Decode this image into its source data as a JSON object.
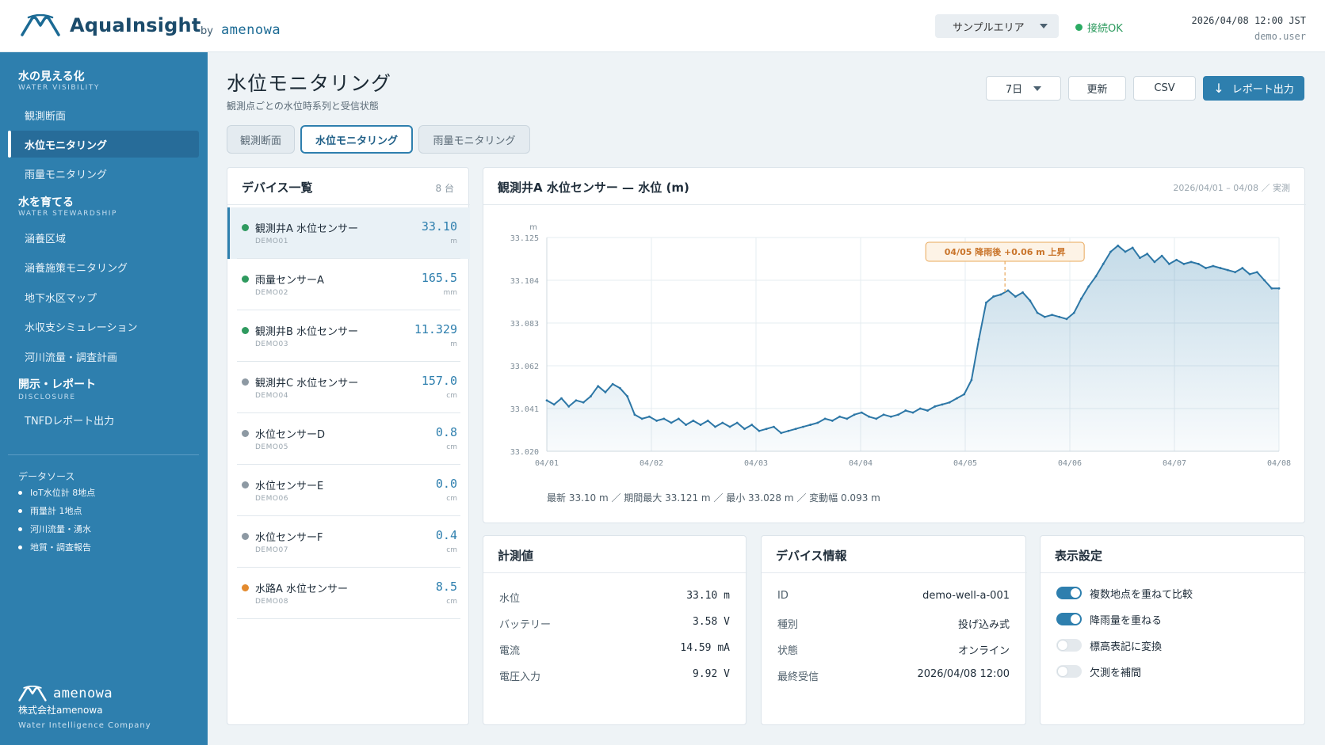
{
  "header": {
    "app_name": "AquaInsight",
    "by": "by",
    "brand": "amenowa",
    "area_select": "サンプルエリア",
    "connection": "接続OK",
    "datetime": "2026/04/08 12:00 JST",
    "user": "demo.user"
  },
  "sidebar": {
    "sections": [
      {
        "title": "水の見える化",
        "sub": "WATER VISIBILITY"
      },
      {
        "title": "水を育てる",
        "sub": "WATER STEWARDSHIP"
      },
      {
        "title": "開示・レポート",
        "sub": "DISCLOSURE"
      }
    ],
    "items": [
      {
        "label": "観測断面"
      },
      {
        "label": "水位モニタリング"
      },
      {
        "label": "雨量モニタリング"
      },
      {
        "label": "涵養区域"
      },
      {
        "label": "涵養施策モニタリング"
      },
      {
        "label": "地下水区マップ"
      },
      {
        "label": "水収支シミュレーション"
      },
      {
        "label": "河川流量・調査計画"
      },
      {
        "label": "TNFDレポート出力"
      }
    ],
    "datasource_title": "データソース",
    "datasources": [
      "IoT水位計 8地点",
      "雨量計 1地点",
      "河川流量・湧水",
      "地質・調査報告"
    ],
    "footer": {
      "brand": "amenowa",
      "company": "株式会社amenowa",
      "tagline": "Water Intelligence Company"
    }
  },
  "page": {
    "title": "水位モニタリング",
    "subtitle": "観測点ごとの水位時系列と受信状態",
    "period_select": "7日",
    "refresh": "更新",
    "csv": "CSV",
    "report_btn": "レポート出力",
    "tabs": [
      "観測断面",
      "水位モニタリング",
      "雨量モニタリング"
    ]
  },
  "devices": {
    "title": "デバイス一覧",
    "count": "8 台",
    "colors": {
      "online": "#2f9a5f",
      "offline": "#8d99a3",
      "warning": "#e38a2e"
    },
    "list": [
      {
        "name": "観測井A 水位センサー",
        "id": "DEMO01",
        "value": "33.10",
        "unit": "m",
        "status": "online"
      },
      {
        "name": "雨量センサーA",
        "id": "DEMO02",
        "value": "165.5",
        "unit": "mm",
        "status": "online"
      },
      {
        "name": "観測井B 水位センサー",
        "id": "DEMO03",
        "value": "11.329",
        "unit": "m",
        "status": "online"
      },
      {
        "name": "観測井C 水位センサー",
        "id": "DEMO04",
        "value": "157.0",
        "unit": "cm",
        "status": "offline"
      },
      {
        "name": "水位センサーD",
        "id": "DEMO05",
        "value": "0.8",
        "unit": "cm",
        "status": "offline"
      },
      {
        "name": "水位センサーE",
        "id": "DEMO06",
        "value": "0.0",
        "unit": "cm",
        "status": "offline"
      },
      {
        "name": "水位センサーF",
        "id": "DEMO07",
        "value": "0.4",
        "unit": "cm",
        "status": "offline"
      },
      {
        "name": "水路A 水位センサー",
        "id": "DEMO08",
        "value": "8.5",
        "unit": "cm",
        "status": "warning"
      }
    ]
  },
  "chart": {
    "title": "観測井A 水位センサー — 水位 (m)",
    "range": "2026/04/01 – 04/08 ／ 実測",
    "stats": "最新 33.10 m ／ 期間最大 33.121 m ／ 最小 33.028 m ／ 変動幅 0.093 m"
  },
  "chart_data": {
    "type": "area",
    "ylabel": "m",
    "ylim": [
      33.02,
      33.125
    ],
    "yticks": [
      "33.125",
      "33.104",
      "33.083",
      "33.062",
      "33.041",
      "33.020"
    ],
    "ytick_values": [
      33.125,
      33.104,
      33.083,
      33.062,
      33.041,
      33.02
    ],
    "xticks": [
      "04/01",
      "04/02",
      "04/03",
      "04/04",
      "04/05",
      "04/06",
      "04/07",
      "04/08"
    ],
    "xlim": [
      0,
      7
    ],
    "annotation": {
      "x": 4.38,
      "text": "04/05 降雨後 +0.06 m 上昇"
    },
    "colors": {
      "line": "#2d77a6",
      "fill": "#2e7fae",
      "annotation_border": "#e9a85a",
      "annotation_text": "#c9742a"
    },
    "series": [
      {
        "x": [
          0,
          0.07,
          0.14,
          0.21,
          0.28,
          0.35,
          0.42,
          0.49,
          0.56,
          0.63,
          0.7,
          0.77,
          0.84,
          0.91,
          0.98,
          1.05,
          1.12,
          1.19,
          1.26,
          1.33,
          1.4,
          1.47,
          1.54,
          1.61,
          1.68,
          1.75,
          1.82,
          1.89,
          1.96,
          2.03,
          2.1,
          2.17,
          2.24,
          2.31,
          2.38,
          2.45,
          2.52,
          2.59,
          2.66,
          2.73,
          2.8,
          2.87,
          2.94,
          3.01,
          3.08,
          3.15,
          3.22,
          3.29,
          3.36,
          3.43,
          3.5,
          3.57,
          3.64,
          3.71,
          3.78,
          3.85,
          3.92,
          3.99,
          4.06,
          4.13,
          4.2,
          4.27,
          4.34,
          4.41,
          4.48,
          4.55,
          4.62,
          4.69,
          4.76,
          4.83,
          4.9,
          4.97,
          5.04,
          5.11,
          5.18,
          5.25,
          5.32,
          5.39,
          5.46,
          5.53,
          5.6,
          5.67,
          5.74,
          5.81,
          5.88,
          5.95,
          6.02,
          6.09,
          6.16,
          6.23,
          6.3,
          6.37,
          6.44,
          6.51,
          6.58,
          6.65,
          6.72,
          6.79,
          6.86,
          6.93,
          7.0
        ],
        "y": [
          33.045,
          33.043,
          33.046,
          33.042,
          33.045,
          33.044,
          33.047,
          33.052,
          33.049,
          33.053,
          33.051,
          33.047,
          33.038,
          33.036,
          33.037,
          33.035,
          33.036,
          33.034,
          33.036,
          33.033,
          33.035,
          33.033,
          33.035,
          33.032,
          33.034,
          33.032,
          33.034,
          33.031,
          33.033,
          33.03,
          33.031,
          33.032,
          33.029,
          33.03,
          33.031,
          33.032,
          33.033,
          33.034,
          33.036,
          33.035,
          33.037,
          33.036,
          33.038,
          33.039,
          33.037,
          33.036,
          33.038,
          33.037,
          33.038,
          33.04,
          33.039,
          33.041,
          33.04,
          33.042,
          33.043,
          33.044,
          33.046,
          33.048,
          33.055,
          33.075,
          33.093,
          33.096,
          33.097,
          33.099,
          33.096,
          33.098,
          33.094,
          33.088,
          33.086,
          33.087,
          33.086,
          33.085,
          33.088,
          33.095,
          33.101,
          33.106,
          33.112,
          33.118,
          33.121,
          33.118,
          33.12,
          33.115,
          33.117,
          33.113,
          33.116,
          33.112,
          33.114,
          33.112,
          33.113,
          33.112,
          33.11,
          33.111,
          33.11,
          33.109,
          33.108,
          33.11,
          33.107,
          33.108,
          33.104,
          33.1,
          33.1
        ]
      }
    ]
  },
  "metrics": {
    "title": "計測値",
    "rows": [
      {
        "k": "水位",
        "v": "33.10 m"
      },
      {
        "k": "バッテリー",
        "v": "3.58 V"
      },
      {
        "k": "電流",
        "v": "14.59 mA"
      },
      {
        "k": "電圧入力",
        "v": "9.92 V"
      }
    ]
  },
  "device_info": {
    "title": "デバイス情報",
    "rows": [
      {
        "k": "ID",
        "v": "demo-well-a-001"
      },
      {
        "k": "種別",
        "v": "投げ込み式"
      },
      {
        "k": "状態",
        "v": "オンライン"
      },
      {
        "k": "最終受信",
        "v": "2026/04/08 12:00"
      }
    ]
  },
  "display_settings": {
    "title": "表示設定",
    "toggles": [
      {
        "label": "複数地点を重ねて比較",
        "on": true
      },
      {
        "label": "降雨量を重ねる",
        "on": true
      },
      {
        "label": "標高表記に変換",
        "on": false
      },
      {
        "label": "欠測を補間",
        "on": false
      }
    ]
  }
}
